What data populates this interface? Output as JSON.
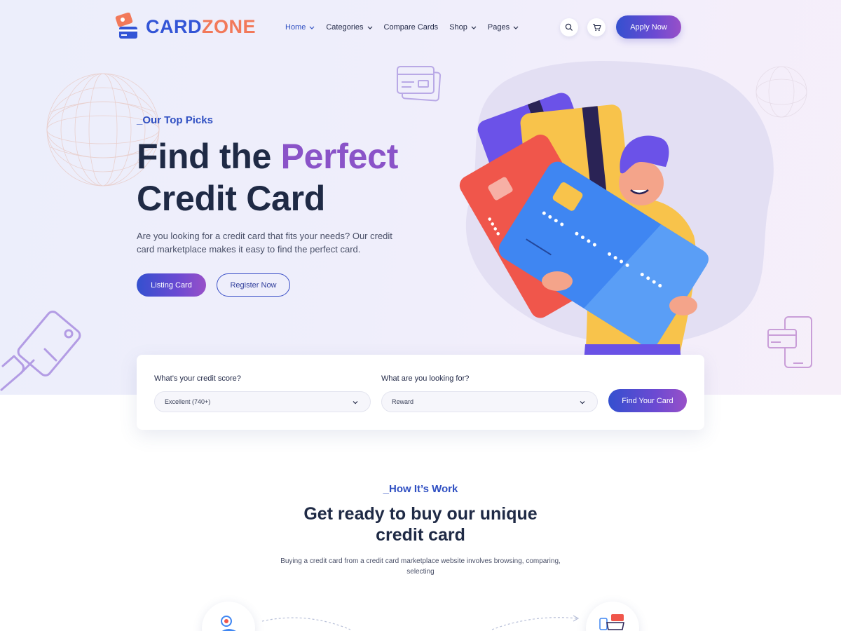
{
  "brand": {
    "part1": "CARD",
    "part2": "ZONE",
    "color1": "#3355d6",
    "color2": "#f2795a"
  },
  "nav": {
    "items": [
      {
        "label": "Home",
        "has_dropdown": true,
        "active": true
      },
      {
        "label": "Categories",
        "has_dropdown": true,
        "active": false
      },
      {
        "label": "Compare Cards",
        "has_dropdown": false,
        "active": false
      },
      {
        "label": "Shop",
        "has_dropdown": true,
        "active": false
      },
      {
        "label": "Pages",
        "has_dropdown": true,
        "active": false
      }
    ],
    "search_icon": "search-icon",
    "cart_icon": "cart-icon",
    "apply_label": "Apply Now"
  },
  "hero": {
    "kicker": "_Our Top Picks",
    "title_part1": "Find the ",
    "title_highlight": "Perfect",
    "title_part2": "Credit Card",
    "description": "Are you looking for a credit card that fits your needs? Our credit card marketplace makes it easy to find the perfect card.",
    "primary_button": "Listing Card",
    "secondary_button": "Register Now",
    "accent_color": "#8a53c8"
  },
  "search": {
    "score_label": "What’s your credit score?",
    "score_value": "Excellent (740+)",
    "looking_label": "What are you looking for?",
    "looking_value": "Reward",
    "button": "Find Your Card"
  },
  "how": {
    "kicker": "_How It’s Work",
    "title": "Get ready to buy our unique credit card",
    "description": "Buying a credit card from a credit card marketplace website involves browsing, comparing, selecting"
  }
}
